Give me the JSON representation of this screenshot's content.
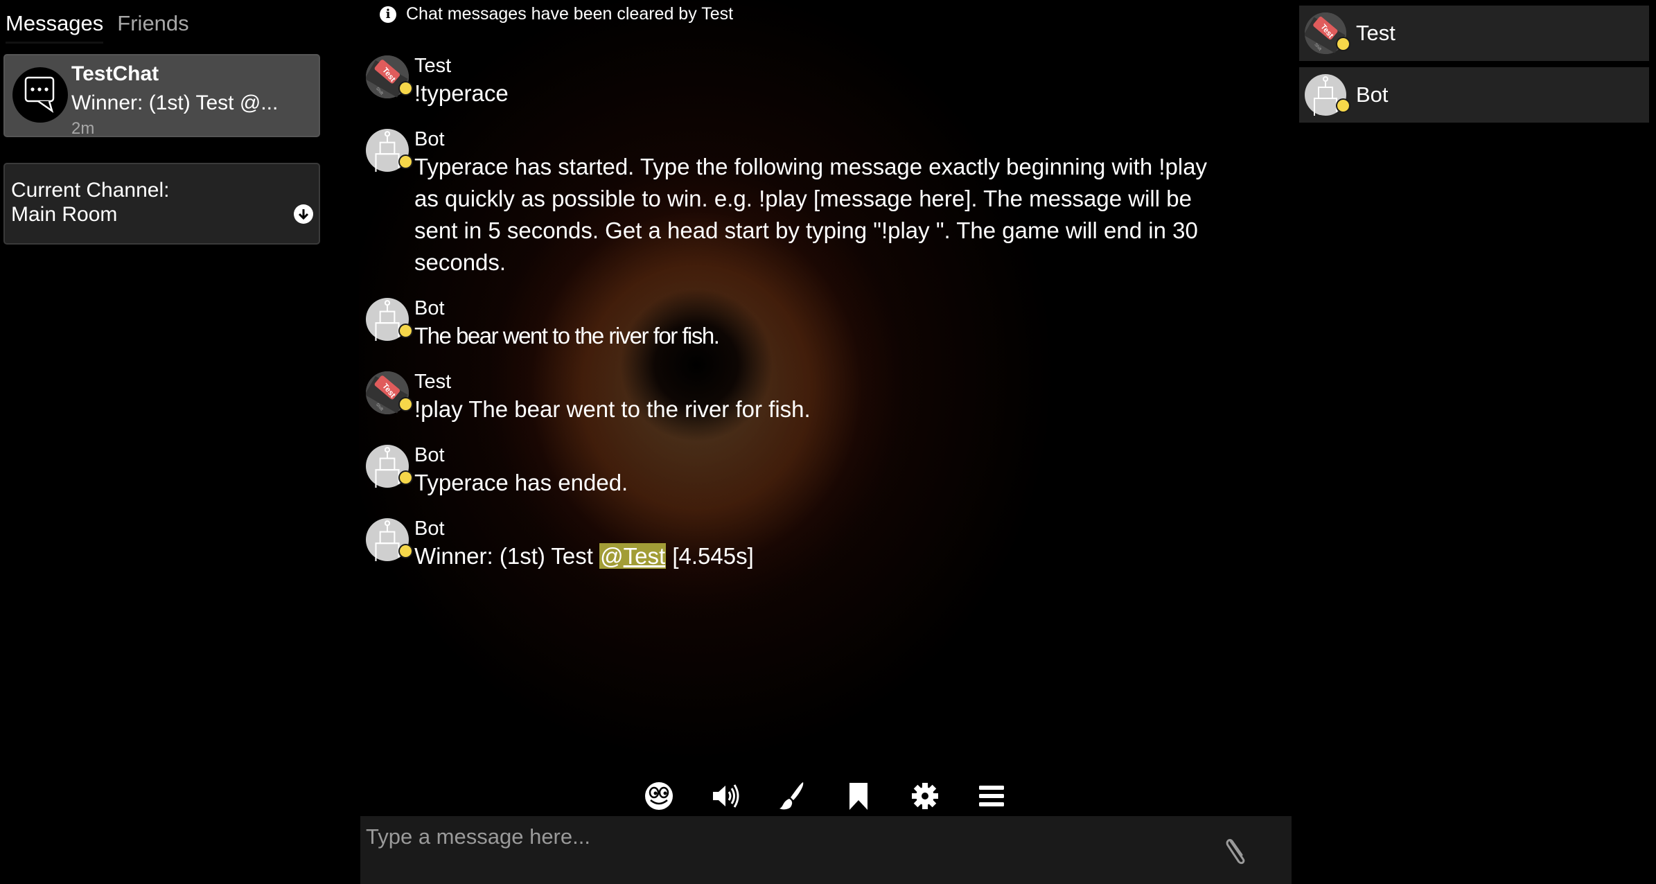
{
  "sidebar": {
    "tabs": [
      {
        "label": "Messages",
        "active": true
      },
      {
        "label": "Friends",
        "active": false
      }
    ],
    "chat": {
      "title": "TestChat",
      "preview": "Winner: (1st) Test @...",
      "time": "2m",
      "icon": "chat-bubble-icon"
    },
    "channel": {
      "label": "Current Channel:",
      "value": "Main Room",
      "icon": "arrow-down-circle-icon"
    }
  },
  "chat": {
    "notice": "Chat messages have been cleared by Test",
    "messages": [
      {
        "author": "Test",
        "avatar": "test",
        "text": "!typerace"
      },
      {
        "author": "Bot",
        "avatar": "bot",
        "text": "Typerace has started. Type the following message exactly beginning with !play as quickly as possible to win. e.g. !play [message here]. The message will be sent in 5 seconds. Get a head start by typing \"!play \". The game will end in 30 seconds."
      },
      {
        "author": "Bot",
        "avatar": "bot",
        "text": "The bear went to the river for fish."
      },
      {
        "author": "Test",
        "avatar": "test",
        "text": "!play The bear went to the river for fish."
      },
      {
        "author": "Bot",
        "avatar": "bot",
        "text": "Typerace has ended."
      },
      {
        "author": "Bot",
        "avatar": "bot",
        "text_before": "Winner: (1st) Test ",
        "mention_at": "@",
        "mention_name": "Test",
        "text_after": " [4.545s]"
      }
    ],
    "toolbar": [
      "emoji-icon",
      "volume-icon",
      "brush-icon",
      "bookmark-icon",
      "settings-icon",
      "menu-icon"
    ],
    "input": {
      "placeholder": "Type a message here...",
      "value": ""
    }
  },
  "users": [
    {
      "name": "Test",
      "avatar": "test",
      "status": "away"
    },
    {
      "name": "Bot",
      "avatar": "bot",
      "status": "away"
    }
  ],
  "colors": {
    "status_dot": "#f6d74a",
    "mention_bg": "#a29d37",
    "card_active": "#4a4a4a",
    "card": "#232323"
  }
}
